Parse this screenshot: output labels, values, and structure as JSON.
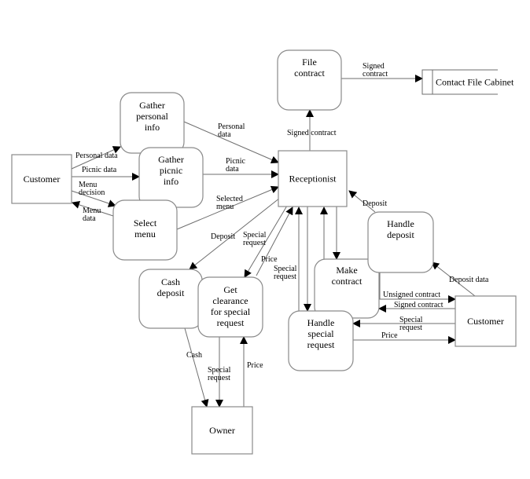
{
  "diagram": {
    "type": "data-flow-diagram",
    "colors": {
      "line": "#6e6e6e",
      "border": "#8a8a8a",
      "arrow": "#000000",
      "background": "#ffffff"
    },
    "nodes": [
      {
        "id": "customer_left",
        "kind": "external-entity",
        "label": [
          "Customer"
        ]
      },
      {
        "id": "gather_personal",
        "kind": "process",
        "label": [
          "Gather",
          "personal",
          "info"
        ]
      },
      {
        "id": "gather_picnic",
        "kind": "process",
        "label": [
          "Gather",
          "picnic",
          "info"
        ]
      },
      {
        "id": "select_menu",
        "kind": "process",
        "label": [
          "Select",
          "menu"
        ]
      },
      {
        "id": "receptionist",
        "kind": "external-entity",
        "label": [
          "Receptionist"
        ]
      },
      {
        "id": "file_contract",
        "kind": "process",
        "label": [
          "File",
          "contract"
        ]
      },
      {
        "id": "contact_file_cabinet",
        "kind": "data-store",
        "label": [
          "Contact File Cabinet"
        ]
      },
      {
        "id": "cash_deposit",
        "kind": "process",
        "label": [
          "Cash",
          "deposit"
        ]
      },
      {
        "id": "get_clearance",
        "kind": "process",
        "label": [
          "Get",
          "clearance",
          "for special",
          "request"
        ]
      },
      {
        "id": "make_contract",
        "kind": "process",
        "label": [
          "Make",
          "contract"
        ]
      },
      {
        "id": "handle_special",
        "kind": "process",
        "label": [
          "Handle",
          "special",
          "request"
        ]
      },
      {
        "id": "handle_deposit",
        "kind": "process",
        "label": [
          "Handle",
          "deposit"
        ]
      },
      {
        "id": "customer_right",
        "kind": "external-entity",
        "label": [
          "Customer"
        ]
      },
      {
        "id": "owner",
        "kind": "external-entity",
        "label": [
          "Owner"
        ]
      }
    ],
    "flows": [
      {
        "from": "customer_left",
        "to": "gather_personal",
        "label": [
          "Personal data"
        ]
      },
      {
        "from": "customer_left",
        "to": "gather_picnic",
        "label": [
          "Picnic data"
        ]
      },
      {
        "from": "customer_left",
        "to": "select_menu",
        "label": [
          "Menu",
          "decision"
        ]
      },
      {
        "from": "select_menu",
        "to": "customer_left",
        "label": [
          "Menu",
          "data"
        ]
      },
      {
        "from": "gather_personal",
        "to": "receptionist",
        "label": [
          "Personal",
          "data"
        ]
      },
      {
        "from": "gather_picnic",
        "to": "receptionist",
        "label": [
          "Picnic",
          "data"
        ]
      },
      {
        "from": "select_menu",
        "to": "receptionist",
        "label": [
          "Selected",
          "menu"
        ]
      },
      {
        "from": "receptionist",
        "to": "file_contract",
        "label": [
          "Signed contract"
        ]
      },
      {
        "from": "file_contract",
        "to": "contact_file_cabinet",
        "label": [
          "Signed",
          "contract"
        ]
      },
      {
        "from": "receptionist",
        "to": "cash_deposit",
        "label": [
          "Deposit"
        ]
      },
      {
        "from": "receptionist",
        "to": "get_clearance",
        "label": [
          "Special",
          "request"
        ]
      },
      {
        "from": "get_clearance",
        "to": "receptionist",
        "label": [
          "Price"
        ]
      },
      {
        "from": "handle_special",
        "to": "receptionist",
        "label": [
          "Special",
          "request"
        ]
      },
      {
        "from": "receptionist",
        "to": "handle_special",
        "label": []
      },
      {
        "from": "make_contract",
        "to": "receptionist",
        "label": []
      },
      {
        "from": "receptionist",
        "to": "make_contract",
        "label": []
      },
      {
        "from": "handle_deposit",
        "to": "receptionist",
        "label": [
          "Deposit"
        ]
      },
      {
        "from": "customer_right",
        "to": "handle_deposit",
        "label": [
          "Deposit data"
        ]
      },
      {
        "from": "make_contract",
        "to": "customer_right",
        "label": [
          "Unsigned contract"
        ]
      },
      {
        "from": "customer_right",
        "to": "make_contract",
        "label": [
          "Signed contract"
        ]
      },
      {
        "from": "customer_right",
        "to": "handle_special",
        "label": [
          "Special",
          "request"
        ]
      },
      {
        "from": "handle_special",
        "to": "customer_right",
        "label": [
          "Price"
        ]
      },
      {
        "from": "cash_deposit",
        "to": "owner",
        "label": [
          "Cash"
        ]
      },
      {
        "from": "get_clearance",
        "to": "owner",
        "label": [
          "Special",
          "request"
        ]
      },
      {
        "from": "owner",
        "to": "get_clearance",
        "label": [
          "Price"
        ]
      }
    ]
  }
}
